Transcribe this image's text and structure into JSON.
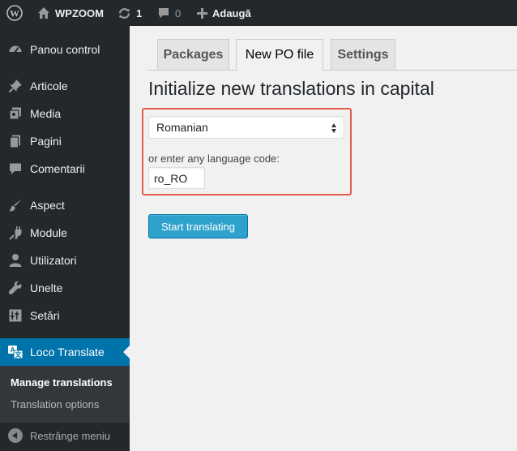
{
  "adminbar": {
    "site_name": "WPZOOM",
    "updates_count": "1",
    "comments_count": "0",
    "new_label": "Adaugă"
  },
  "sidebar": {
    "items": [
      {
        "label": "Panou control",
        "icon": "dashboard-icon"
      },
      {
        "label": "Articole",
        "icon": "pin-icon"
      },
      {
        "label": "Media",
        "icon": "media-icon"
      },
      {
        "label": "Pagini",
        "icon": "pages-icon"
      },
      {
        "label": "Comentarii",
        "icon": "comment-icon"
      },
      {
        "label": "Aspect",
        "icon": "brush-icon"
      },
      {
        "label": "Module",
        "icon": "plugin-icon"
      },
      {
        "label": "Utilizatori",
        "icon": "user-icon"
      },
      {
        "label": "Unelte",
        "icon": "wrench-icon"
      },
      {
        "label": "Setări",
        "icon": "settings-icon"
      },
      {
        "label": "Loco Translate",
        "icon": "translate-icon"
      }
    ],
    "submenu": [
      "Manage translations",
      "Translation options"
    ],
    "collapse_label": "Restrânge meniu"
  },
  "tabs": [
    "Packages",
    "New PO file",
    "Settings"
  ],
  "page_title": "Initialize new translations in capital",
  "language_select": {
    "value": "Romanian"
  },
  "code_label": "or enter any language code:",
  "code_input": {
    "value": "ro_RO"
  },
  "start_button": "Start translating",
  "colors": {
    "accent": "#0073aa",
    "button": "#2ea2cc",
    "highlight": "#e35d4e"
  }
}
